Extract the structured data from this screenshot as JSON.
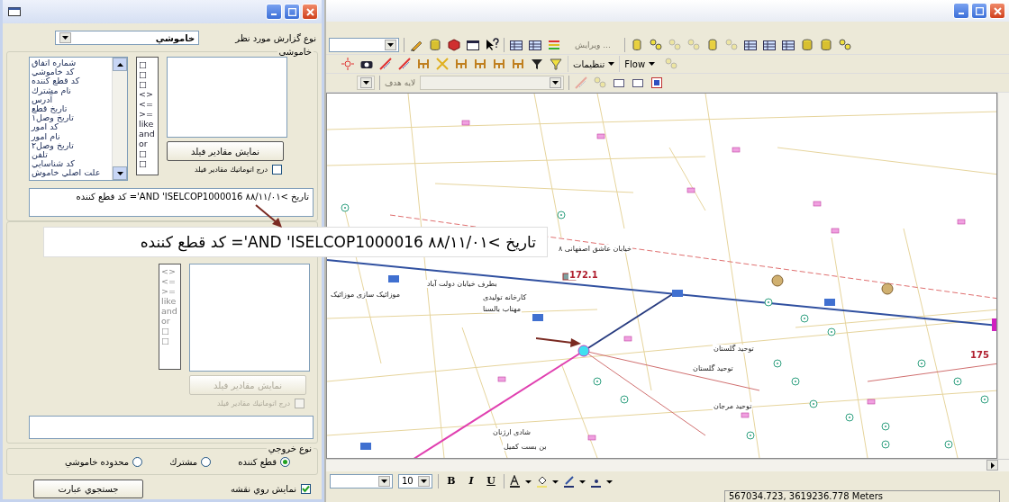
{
  "dialog": {
    "report_type": {
      "label": "نوع گزارش مورد نظر",
      "value": "خاموشي"
    },
    "group_1": {
      "title": "خاموشي",
      "fields": [
        "شماره اتفاق",
        "كد خاموشي",
        "كد قطع كننده",
        "نام مشترك",
        "آدرس",
        "تاريخ قطع",
        "تاريخ وصل۱",
        "كد امور",
        "نام امور",
        "تاريخ وصل۲",
        "تلفن",
        "كد شناسايي",
        "علت اصلي خاموش"
      ],
      "operators": [
        "□",
        "□",
        "□",
        "<>",
        "<=",
        ">=",
        "like",
        "and",
        "or",
        "□",
        "□"
      ],
      "show_values_button": {
        "label": "نمایش مقادیر فیلد",
        "disabled": false
      },
      "auto_insert": {
        "label": "درج اتوماتيك مقادير فيلد",
        "checked": false,
        "disabled": false
      },
      "query": "تاریخ >۸۸/۱۱/۰۱ AND 'ISELCOP1000016'= کد قطع کننده"
    },
    "group_2": {
      "operators": [
        "<>",
        "<=",
        ">=",
        "like",
        "and",
        "or",
        "□",
        "□"
      ],
      "show_values_button": {
        "label": "نمایش مقادیر فیلد",
        "disabled": true
      },
      "auto_insert": {
        "label": "درج اتوماتيك مقادير فيلد",
        "checked": false,
        "disabled": true
      }
    },
    "output_type": {
      "title": "نوع خروجي",
      "options": [
        {
          "label": "قطع كننده",
          "selected": true
        },
        {
          "label": "مشترك",
          "selected": false
        },
        {
          "label": "محدوده خاموشي",
          "selected": false
        }
      ]
    },
    "show_on_map": {
      "label": "نمایش روي نقشه",
      "checked": true
    },
    "search_button": "جستجوي عبارت"
  },
  "callout": {
    "text": "تاریخ >۸۸/۱۱/۰۱ AND 'ISELCOP1000016'= کد قطع کننده"
  },
  "map_window": {
    "toolbar_1": {
      "edit_menu": {
        "label": "ویرایش ...",
        "disabled": true
      }
    },
    "toolbar_2": {
      "menus": [
        "Flow",
        "تنظیمات"
      ]
    },
    "toolbar_3": {
      "target_layer": {
        "label": "لایه هدف",
        "disabled": true
      }
    },
    "map": {
      "labels": [
        {
          "text": "خیابان عاشق اصفهانی ۸",
          "kind": "street"
        },
        {
          "text": "172.1",
          "kind": "measure"
        },
        {
          "text": "بطرف خیابان دولت آباد",
          "kind": "street"
        },
        {
          "text": "کارخانه تولیدی",
          "kind": "street"
        },
        {
          "text": "موزائیک سازی موزائیک",
          "kind": "street"
        },
        {
          "text": "مهتاب بالسنا",
          "kind": "street"
        },
        {
          "text": "توحید گلستان",
          "kind": "street"
        },
        {
          "text": "توحید گلستان",
          "kind": "street"
        },
        {
          "text": "توحید مرجان",
          "kind": "street"
        },
        {
          "text": "شادی ارژنان",
          "kind": "street"
        },
        {
          "text": "بن بست کمیل",
          "kind": "street"
        },
        {
          "text": "175",
          "kind": "measure"
        }
      ]
    },
    "format_bar": {
      "font_size": "10",
      "bold": "B",
      "italic": "I",
      "underline": "U"
    },
    "status_bar": {
      "coordinates": "567034.723, 3619236.778 Meters"
    }
  }
}
